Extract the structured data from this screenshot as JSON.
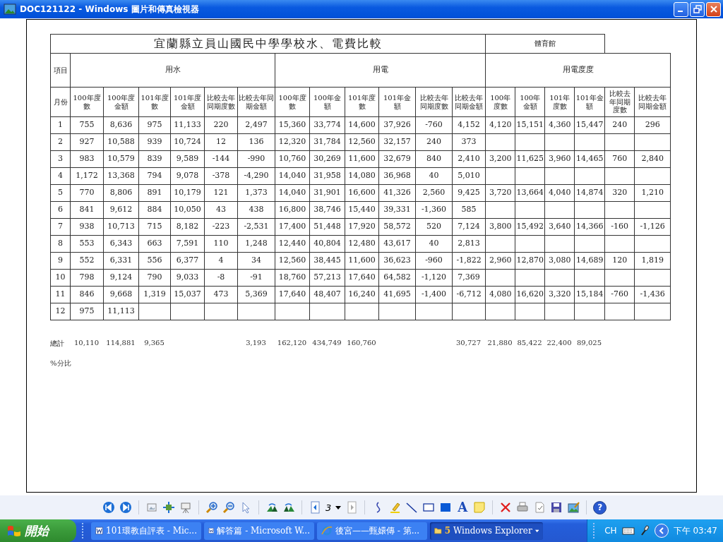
{
  "window": {
    "title": "DOC121122 - Windows 圖片和傳真檢視器"
  },
  "document": {
    "title": "宜蘭縣立員山國民中學學校水、電費比較",
    "side_label": "體育館",
    "item_label": "項目",
    "month_label": "月份",
    "groups": [
      {
        "label": "用水",
        "columns": [
          {
            "label": "100年度數",
            "total": "10,110"
          },
          {
            "label": "100年度金額",
            "total": "114,881"
          },
          {
            "label": "101年度數",
            "total": "9,365"
          },
          {
            "label": "101年度金額"
          },
          {
            "label": "比較去年同期度數"
          },
          {
            "label": "比較去年同期金額",
            "total": "3,193"
          }
        ]
      },
      {
        "label": "用電",
        "columns": [
          {
            "label": "100年度數",
            "total": "162,120"
          },
          {
            "label": "100年金額",
            "total": "434,749"
          },
          {
            "label": "101年度數",
            "total": "160,760"
          },
          {
            "label": "101年金額"
          },
          {
            "label": "比較去年同期度數"
          },
          {
            "label": "比較去年同期金額",
            "total": "30,727"
          }
        ]
      },
      {
        "label": "用電度度",
        "columns": [
          {
            "label": "100年度數",
            "total": "21,880"
          },
          {
            "label": "100年金額",
            "total": "85,422"
          },
          {
            "label": "101年度數",
            "total": "22,400"
          },
          {
            "label": "101年金額",
            "total": "89,025"
          },
          {
            "label": "比較去年同期度數"
          },
          {
            "label": "比較去年同期金額"
          }
        ]
      }
    ],
    "rows": [
      {
        "month": "1",
        "cells": [
          "755",
          "8,636",
          "975",
          "11,133",
          "220",
          "2,497",
          "15,360",
          "33,774",
          "14,600",
          "37,926",
          "-760",
          "4,152",
          "4,120",
          "15,151",
          "4,360",
          "15,447",
          "240",
          "296"
        ]
      },
      {
        "month": "2",
        "cells": [
          "927",
          "10,588",
          "939",
          "10,724",
          "12",
          "136",
          "12,320",
          "31,784",
          "12,560",
          "32,157",
          "240",
          "373",
          null,
          null,
          null,
          null,
          null,
          null
        ]
      },
      {
        "month": "3",
        "cells": [
          "983",
          "10,579",
          "839",
          "9,589",
          "-144",
          "-990",
          "10,760",
          "30,269",
          "11,600",
          "32,679",
          "840",
          "2,410",
          "3,200",
          "11,625",
          "3,960",
          "14,465",
          "760",
          "2,840"
        ]
      },
      {
        "month": "4",
        "cells": [
          "1,172",
          "13,368",
          "794",
          "9,078",
          "-378",
          "-4,290",
          "14,040",
          "31,958",
          "14,080",
          "36,968",
          "40",
          "5,010",
          null,
          null,
          null,
          null,
          null,
          null
        ]
      },
      {
        "month": "5",
        "cells": [
          "770",
          "8,806",
          "891",
          "10,179",
          "121",
          "1,373",
          "14,040",
          "31,901",
          "16,600",
          "41,326",
          "2,560",
          "9,425",
          "3,720",
          "13,664",
          "4,040",
          "14,874",
          "320",
          "1,210"
        ]
      },
      {
        "month": "6",
        "cells": [
          "841",
          "9,612",
          "884",
          "10,050",
          "43",
          "438",
          "16,800",
          "38,746",
          "15,440",
          "39,331",
          "-1,360",
          "585",
          null,
          null,
          null,
          null,
          null,
          null
        ]
      },
      {
        "month": "7",
        "cells": [
          "938",
          "10,713",
          "715",
          "8,182",
          "-223",
          "-2,531",
          "17,400",
          "51,448",
          "17,920",
          "58,572",
          "520",
          "7,124",
          "3,800",
          "15,492",
          "3,640",
          "14,366",
          "-160",
          "-1,126"
        ]
      },
      {
        "month": "8",
        "cells": [
          "553",
          "6,343",
          "663",
          "7,591",
          "110",
          "1,248",
          "12,440",
          "40,804",
          "12,480",
          "43,617",
          "40",
          "2,813",
          null,
          null,
          null,
          null,
          null,
          null
        ]
      },
      {
        "month": "9",
        "cells": [
          "552",
          "6,331",
          "556",
          "6,377",
          "4",
          "34",
          "12,560",
          "38,445",
          "11,600",
          "36,623",
          "-960",
          "-1,822",
          "2,960",
          "12,870",
          "3,080",
          "14,689",
          "120",
          "1,819"
        ]
      },
      {
        "month": "10",
        "cells": [
          "798",
          "9,124",
          "790",
          "9,033",
          "-8",
          "-91",
          "18,760",
          "57,213",
          "17,640",
          "64,582",
          "-1,120",
          "7,369",
          null,
          null,
          null,
          null,
          null,
          null
        ]
      },
      {
        "month": "11",
        "cells": [
          "846",
          "9,668",
          "1,319",
          "15,037",
          "473",
          "5,369",
          "17,640",
          "48,407",
          "16,240",
          "41,695",
          "-1,400",
          "-6,712",
          "4,080",
          "16,620",
          "3,320",
          "15,184",
          "-760",
          "-1,436"
        ]
      },
      {
        "month": "12",
        "cells": [
          "975",
          "11,113",
          null,
          null,
          null,
          null,
          null,
          null,
          null,
          null,
          null,
          null,
          null,
          null,
          null,
          null,
          null,
          null
        ]
      }
    ],
    "totals_label": "總計",
    "percent_label": "%分比"
  },
  "toolbar": {
    "page": "3",
    "text_tool": "A",
    "help": "?"
  },
  "taskbar": {
    "start": "開始",
    "tasks": [
      {
        "kind": "word",
        "label": "101環教自評表 - Mic...",
        "selected": false
      },
      {
        "kind": "word",
        "label": "解答篇 - Microsoft W...",
        "selected": false
      },
      {
        "kind": "browser",
        "label": "後宮——甄嬛傳 - 第...",
        "selected": false
      },
      {
        "kind": "folder",
        "count": "5",
        "label": "Windows Explorer",
        "selected": true
      }
    ],
    "language": "CH",
    "clock": "下午 03:47"
  }
}
